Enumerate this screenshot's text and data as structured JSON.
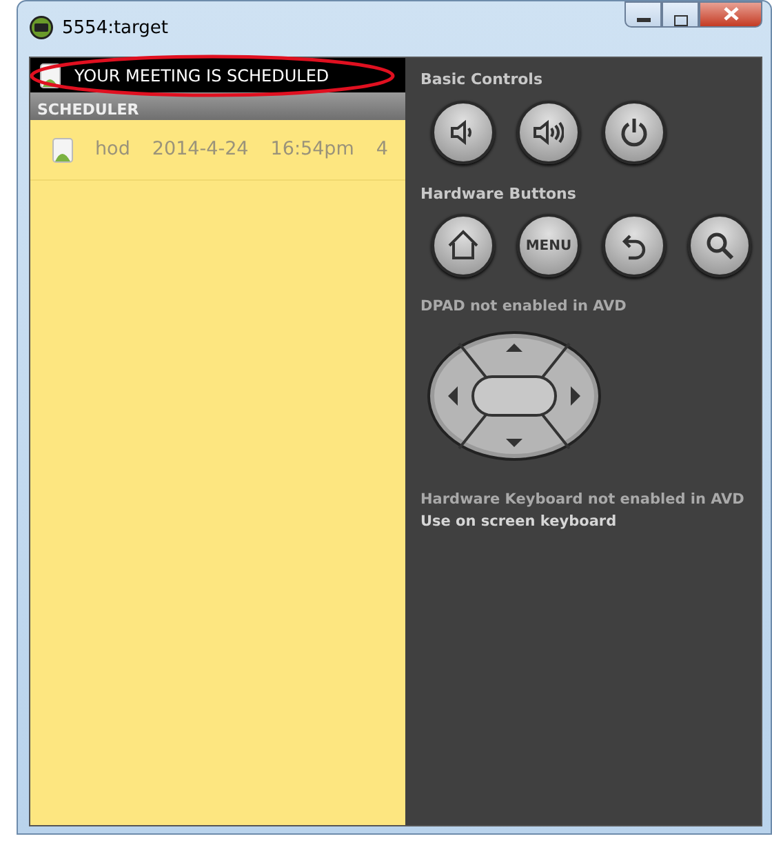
{
  "window": {
    "title": "5554:target"
  },
  "notification": {
    "text": "YOUR MEETING IS SCHEDULED",
    "highlighted": true
  },
  "app": {
    "title": "SCHEDULER"
  },
  "rows": [
    {
      "cells": [
        "hod",
        "2014-4-24",
        "16:54pm",
        "4"
      ]
    }
  ],
  "controls": {
    "basic_label": "Basic Controls",
    "basic": [
      {
        "kind": "volume-down"
      },
      {
        "kind": "volume-up"
      },
      {
        "kind": "power"
      }
    ],
    "hardware_label": "Hardware Buttons",
    "hardware": [
      {
        "kind": "home"
      },
      {
        "kind": "menu",
        "label": "MENU"
      },
      {
        "kind": "back"
      },
      {
        "kind": "search"
      }
    ],
    "dpad_label": "**DPAD** not enabled in AVD",
    "keyboard_label": "**Hardware Keyboard** not enabled in AVD",
    "keyboard_hint": "Use on screen keyboard"
  }
}
